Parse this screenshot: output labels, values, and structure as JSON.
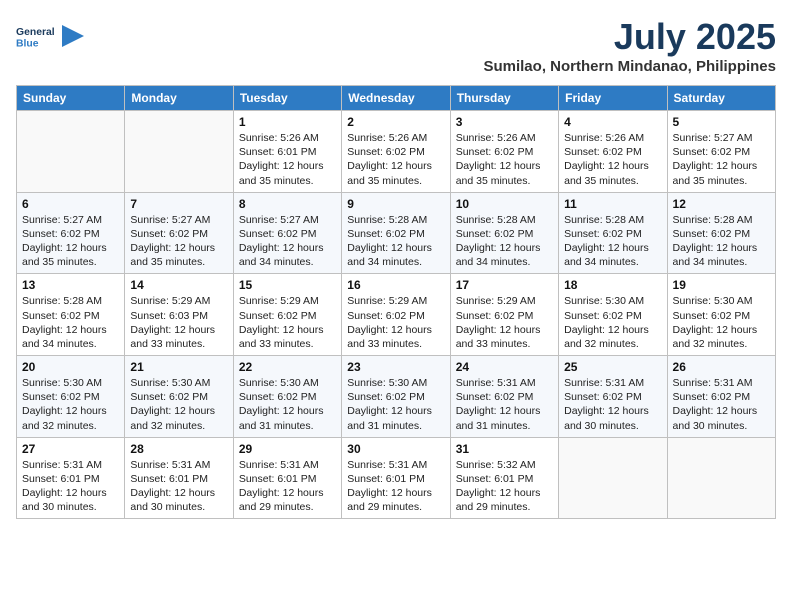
{
  "logo": {
    "line1": "General",
    "line2": "Blue"
  },
  "title": {
    "month": "July 2025",
    "location": "Sumilao, Northern Mindanao, Philippines"
  },
  "headers": [
    "Sunday",
    "Monday",
    "Tuesday",
    "Wednesday",
    "Thursday",
    "Friday",
    "Saturday"
  ],
  "weeks": [
    [
      {
        "day": "",
        "info": ""
      },
      {
        "day": "",
        "info": ""
      },
      {
        "day": "1",
        "info": "Sunrise: 5:26 AM\nSunset: 6:01 PM\nDaylight: 12 hours and 35 minutes."
      },
      {
        "day": "2",
        "info": "Sunrise: 5:26 AM\nSunset: 6:02 PM\nDaylight: 12 hours and 35 minutes."
      },
      {
        "day": "3",
        "info": "Sunrise: 5:26 AM\nSunset: 6:02 PM\nDaylight: 12 hours and 35 minutes."
      },
      {
        "day": "4",
        "info": "Sunrise: 5:26 AM\nSunset: 6:02 PM\nDaylight: 12 hours and 35 minutes."
      },
      {
        "day": "5",
        "info": "Sunrise: 5:27 AM\nSunset: 6:02 PM\nDaylight: 12 hours and 35 minutes."
      }
    ],
    [
      {
        "day": "6",
        "info": "Sunrise: 5:27 AM\nSunset: 6:02 PM\nDaylight: 12 hours and 35 minutes."
      },
      {
        "day": "7",
        "info": "Sunrise: 5:27 AM\nSunset: 6:02 PM\nDaylight: 12 hours and 35 minutes."
      },
      {
        "day": "8",
        "info": "Sunrise: 5:27 AM\nSunset: 6:02 PM\nDaylight: 12 hours and 34 minutes."
      },
      {
        "day": "9",
        "info": "Sunrise: 5:28 AM\nSunset: 6:02 PM\nDaylight: 12 hours and 34 minutes."
      },
      {
        "day": "10",
        "info": "Sunrise: 5:28 AM\nSunset: 6:02 PM\nDaylight: 12 hours and 34 minutes."
      },
      {
        "day": "11",
        "info": "Sunrise: 5:28 AM\nSunset: 6:02 PM\nDaylight: 12 hours and 34 minutes."
      },
      {
        "day": "12",
        "info": "Sunrise: 5:28 AM\nSunset: 6:02 PM\nDaylight: 12 hours and 34 minutes."
      }
    ],
    [
      {
        "day": "13",
        "info": "Sunrise: 5:28 AM\nSunset: 6:02 PM\nDaylight: 12 hours and 34 minutes."
      },
      {
        "day": "14",
        "info": "Sunrise: 5:29 AM\nSunset: 6:03 PM\nDaylight: 12 hours and 33 minutes."
      },
      {
        "day": "15",
        "info": "Sunrise: 5:29 AM\nSunset: 6:02 PM\nDaylight: 12 hours and 33 minutes."
      },
      {
        "day": "16",
        "info": "Sunrise: 5:29 AM\nSunset: 6:02 PM\nDaylight: 12 hours and 33 minutes."
      },
      {
        "day": "17",
        "info": "Sunrise: 5:29 AM\nSunset: 6:02 PM\nDaylight: 12 hours and 33 minutes."
      },
      {
        "day": "18",
        "info": "Sunrise: 5:30 AM\nSunset: 6:02 PM\nDaylight: 12 hours and 32 minutes."
      },
      {
        "day": "19",
        "info": "Sunrise: 5:30 AM\nSunset: 6:02 PM\nDaylight: 12 hours and 32 minutes."
      }
    ],
    [
      {
        "day": "20",
        "info": "Sunrise: 5:30 AM\nSunset: 6:02 PM\nDaylight: 12 hours and 32 minutes."
      },
      {
        "day": "21",
        "info": "Sunrise: 5:30 AM\nSunset: 6:02 PM\nDaylight: 12 hours and 32 minutes."
      },
      {
        "day": "22",
        "info": "Sunrise: 5:30 AM\nSunset: 6:02 PM\nDaylight: 12 hours and 31 minutes."
      },
      {
        "day": "23",
        "info": "Sunrise: 5:30 AM\nSunset: 6:02 PM\nDaylight: 12 hours and 31 minutes."
      },
      {
        "day": "24",
        "info": "Sunrise: 5:31 AM\nSunset: 6:02 PM\nDaylight: 12 hours and 31 minutes."
      },
      {
        "day": "25",
        "info": "Sunrise: 5:31 AM\nSunset: 6:02 PM\nDaylight: 12 hours and 30 minutes."
      },
      {
        "day": "26",
        "info": "Sunrise: 5:31 AM\nSunset: 6:02 PM\nDaylight: 12 hours and 30 minutes."
      }
    ],
    [
      {
        "day": "27",
        "info": "Sunrise: 5:31 AM\nSunset: 6:01 PM\nDaylight: 12 hours and 30 minutes."
      },
      {
        "day": "28",
        "info": "Sunrise: 5:31 AM\nSunset: 6:01 PM\nDaylight: 12 hours and 30 minutes."
      },
      {
        "day": "29",
        "info": "Sunrise: 5:31 AM\nSunset: 6:01 PM\nDaylight: 12 hours and 29 minutes."
      },
      {
        "day": "30",
        "info": "Sunrise: 5:31 AM\nSunset: 6:01 PM\nDaylight: 12 hours and 29 minutes."
      },
      {
        "day": "31",
        "info": "Sunrise: 5:32 AM\nSunset: 6:01 PM\nDaylight: 12 hours and 29 minutes."
      },
      {
        "day": "",
        "info": ""
      },
      {
        "day": "",
        "info": ""
      }
    ]
  ]
}
